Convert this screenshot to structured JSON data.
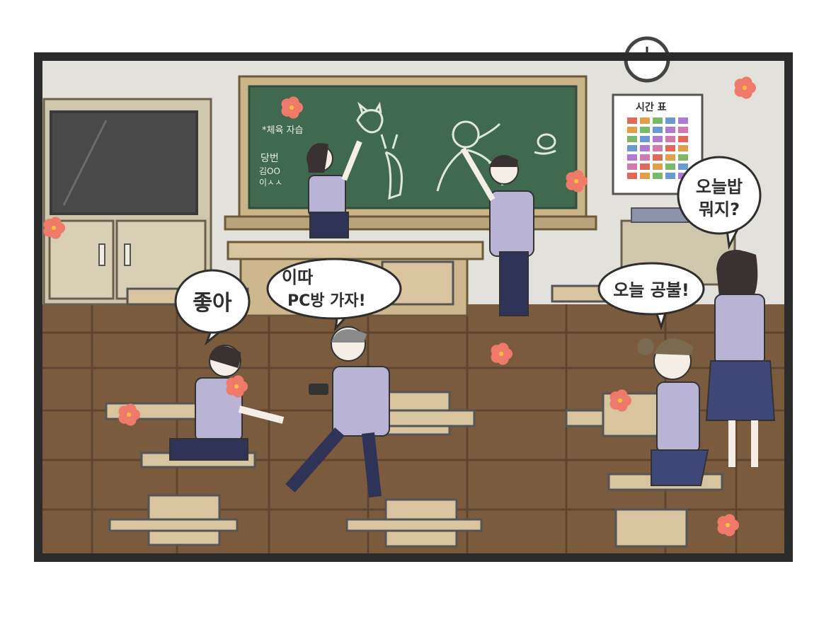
{
  "board": {
    "notice": "*체육 자습",
    "duty_label": "당번",
    "duty_names": [
      "김OO",
      "이ㅅㅅ"
    ]
  },
  "timetable": {
    "title": "시간 표"
  },
  "speech": {
    "left": "좋아",
    "middle_line1": "이따",
    "middle_line2": "PC방 가자!",
    "right_front": "오늘 공불!",
    "right_back_line1": "오늘밥",
    "right_back_line2": "뭐지?"
  },
  "colors": {
    "frame": "#2b2b2b",
    "wall": "#e3e1dc",
    "chalkboard": "#3f6a4f",
    "floor": "#7a5b3e",
    "uniform_shirt": "#b9b4d6",
    "uniform_pants": "#2f3358",
    "desk_top": "#d8c49e",
    "flower": "#f07a6a"
  }
}
